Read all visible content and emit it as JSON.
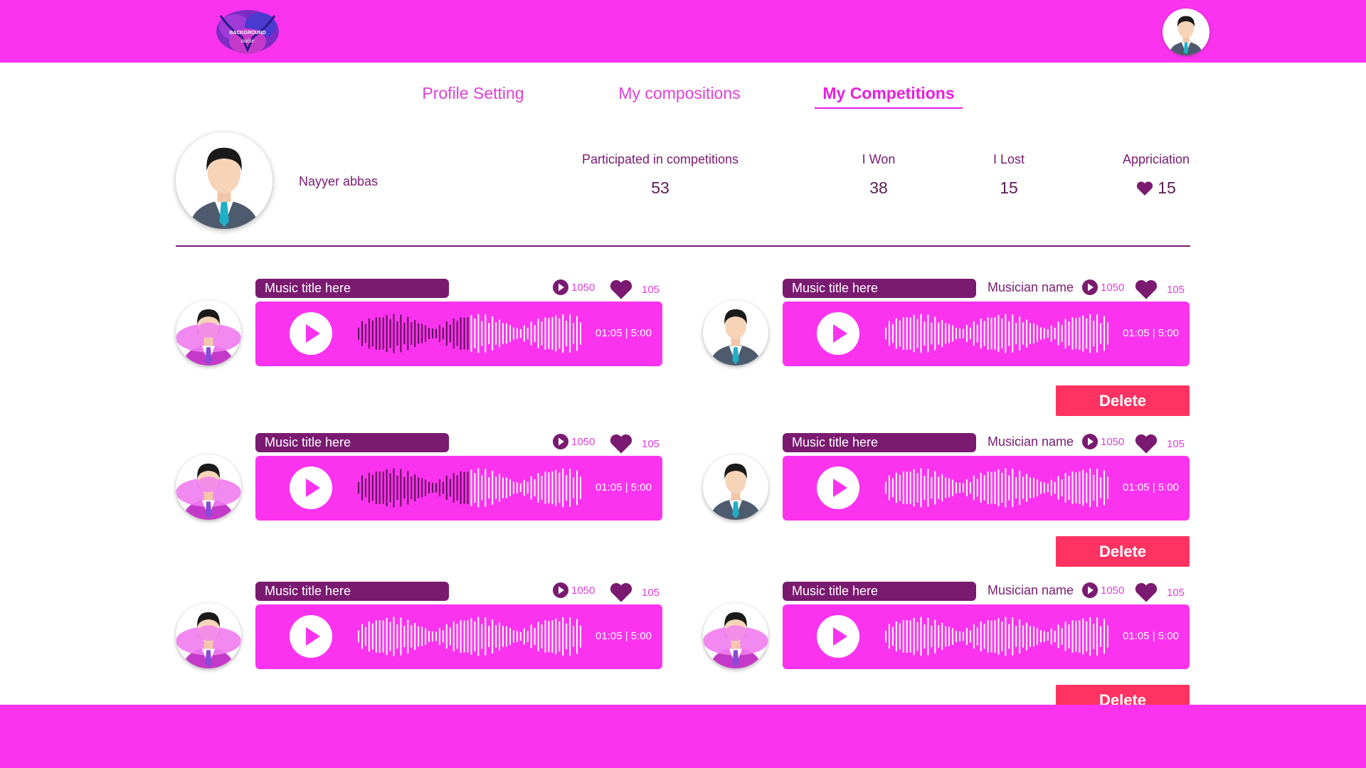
{
  "brand": {
    "logo_text_line1": "BACKGROUND",
    "logo_text_line2": "noise"
  },
  "colors": {
    "accent": "#fb33ef",
    "dark": "#7a1a70",
    "delete": "#fe3361"
  },
  "tabs": [
    {
      "label": "Profile Setting",
      "active": false
    },
    {
      "label": "My compositions",
      "active": false
    },
    {
      "label": "My Competitions",
      "active": true
    }
  ],
  "profile": {
    "name": "Nayyer abbas",
    "stats": [
      {
        "label": "Participated in competitions",
        "value": "53"
      },
      {
        "label": "I Won",
        "value": "38"
      },
      {
        "label": "I Lost",
        "value": "15"
      },
      {
        "label": "Appriciation",
        "value": "15",
        "icon": "heart-icon"
      }
    ]
  },
  "cards": [
    {
      "title": "Music title here",
      "musician": "",
      "plays": "1050",
      "likes": "105",
      "time": "01:05 | 5:00",
      "progress": 0.5
    },
    {
      "title": "Music title here",
      "musician": "Musician name",
      "plays": "1050",
      "likes": "105",
      "time": "01:05 | 5:00",
      "progress": 0
    },
    {
      "title": "Music title here",
      "musician": "",
      "plays": "1050",
      "likes": "105",
      "time": "01:05 | 5:00",
      "progress": 0.5
    },
    {
      "title": "Music title here",
      "musician": "Musician name",
      "plays": "1050",
      "likes": "105",
      "time": "01:05 | 5:00",
      "progress": 0
    },
    {
      "title": "Music title here",
      "musician": "",
      "plays": "1050",
      "likes": "105",
      "time": "01:05 | 5:00",
      "progress": 0
    },
    {
      "title": "Music title here",
      "musician": "Musician name",
      "plays": "1050",
      "likes": "105",
      "time": "01:05 | 5:00",
      "progress": 0
    }
  ],
  "delete_label": "Delete"
}
